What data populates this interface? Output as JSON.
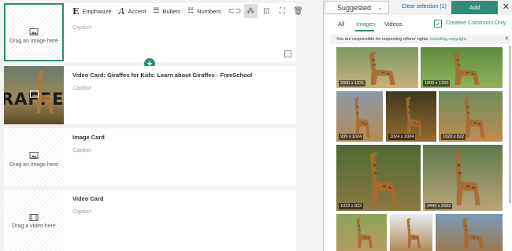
{
  "toolbar": {
    "emphasize": "Emphasize",
    "accent": "Accent",
    "bullets": "Bullets",
    "numbers": "Numbers"
  },
  "cards": [
    {
      "title": "",
      "caption": "Caption",
      "placeholder": "Drag an image here"
    },
    {
      "title": "Video Card: Giraffes for Kids: Learn about Giraffes - FreeSchool",
      "caption": "Caption",
      "thumb_text": "RAFFES"
    },
    {
      "title": "Image Card",
      "caption": "Caption",
      "placeholder": "Drag an image here"
    },
    {
      "title": "Video Card",
      "caption": "Caption",
      "placeholder": "Drag a video here"
    }
  ],
  "panel": {
    "source": "Suggested",
    "clear_selection": "Clear selection (1)",
    "add": "Add",
    "tabs": [
      "All",
      "Images",
      "Videos"
    ],
    "active_tab": "Images",
    "creative_commons": "Creative Commons Only",
    "notice": "You are responsible for respecting others' rights, ",
    "notice_link": "including copyright."
  },
  "images": [
    {
      "dims": "2000 x 1331",
      "colors": [
        "#7b9a62",
        "#c9b27a"
      ]
    },
    {
      "dims": "1800 x 1200",
      "colors": [
        "#5f8a3e",
        "#8fb35a"
      ]
    },
    {
      "dims": "939 x 1024",
      "colors": [
        "#8a9aa8",
        "#b58a52"
      ]
    },
    {
      "dims": "1024 x 1024",
      "colors": [
        "#3d3a1e",
        "#9a6a2e"
      ]
    },
    {
      "dims": "1023 x 822",
      "colors": [
        "#6d8f5a",
        "#c08a52"
      ]
    },
    {
      "dims": "1023 x 822",
      "colors": [
        "#4f6a32",
        "#8a7a42"
      ]
    },
    {
      "dims": "3442 x 2932",
      "colors": [
        "#5f7a4a",
        "#b9a57a"
      ]
    },
    {
      "dims": "",
      "colors": [
        "#8aa45a",
        "#b79a5e"
      ]
    },
    {
      "dims": "",
      "colors": [
        "#e8ecf0",
        "#b08a56"
      ]
    },
    {
      "dims": "",
      "colors": [
        "#7a9ab8",
        "#9a7a4e"
      ]
    }
  ],
  "colors": {
    "accent": "#2f8b7a",
    "link": "#005a9e"
  }
}
